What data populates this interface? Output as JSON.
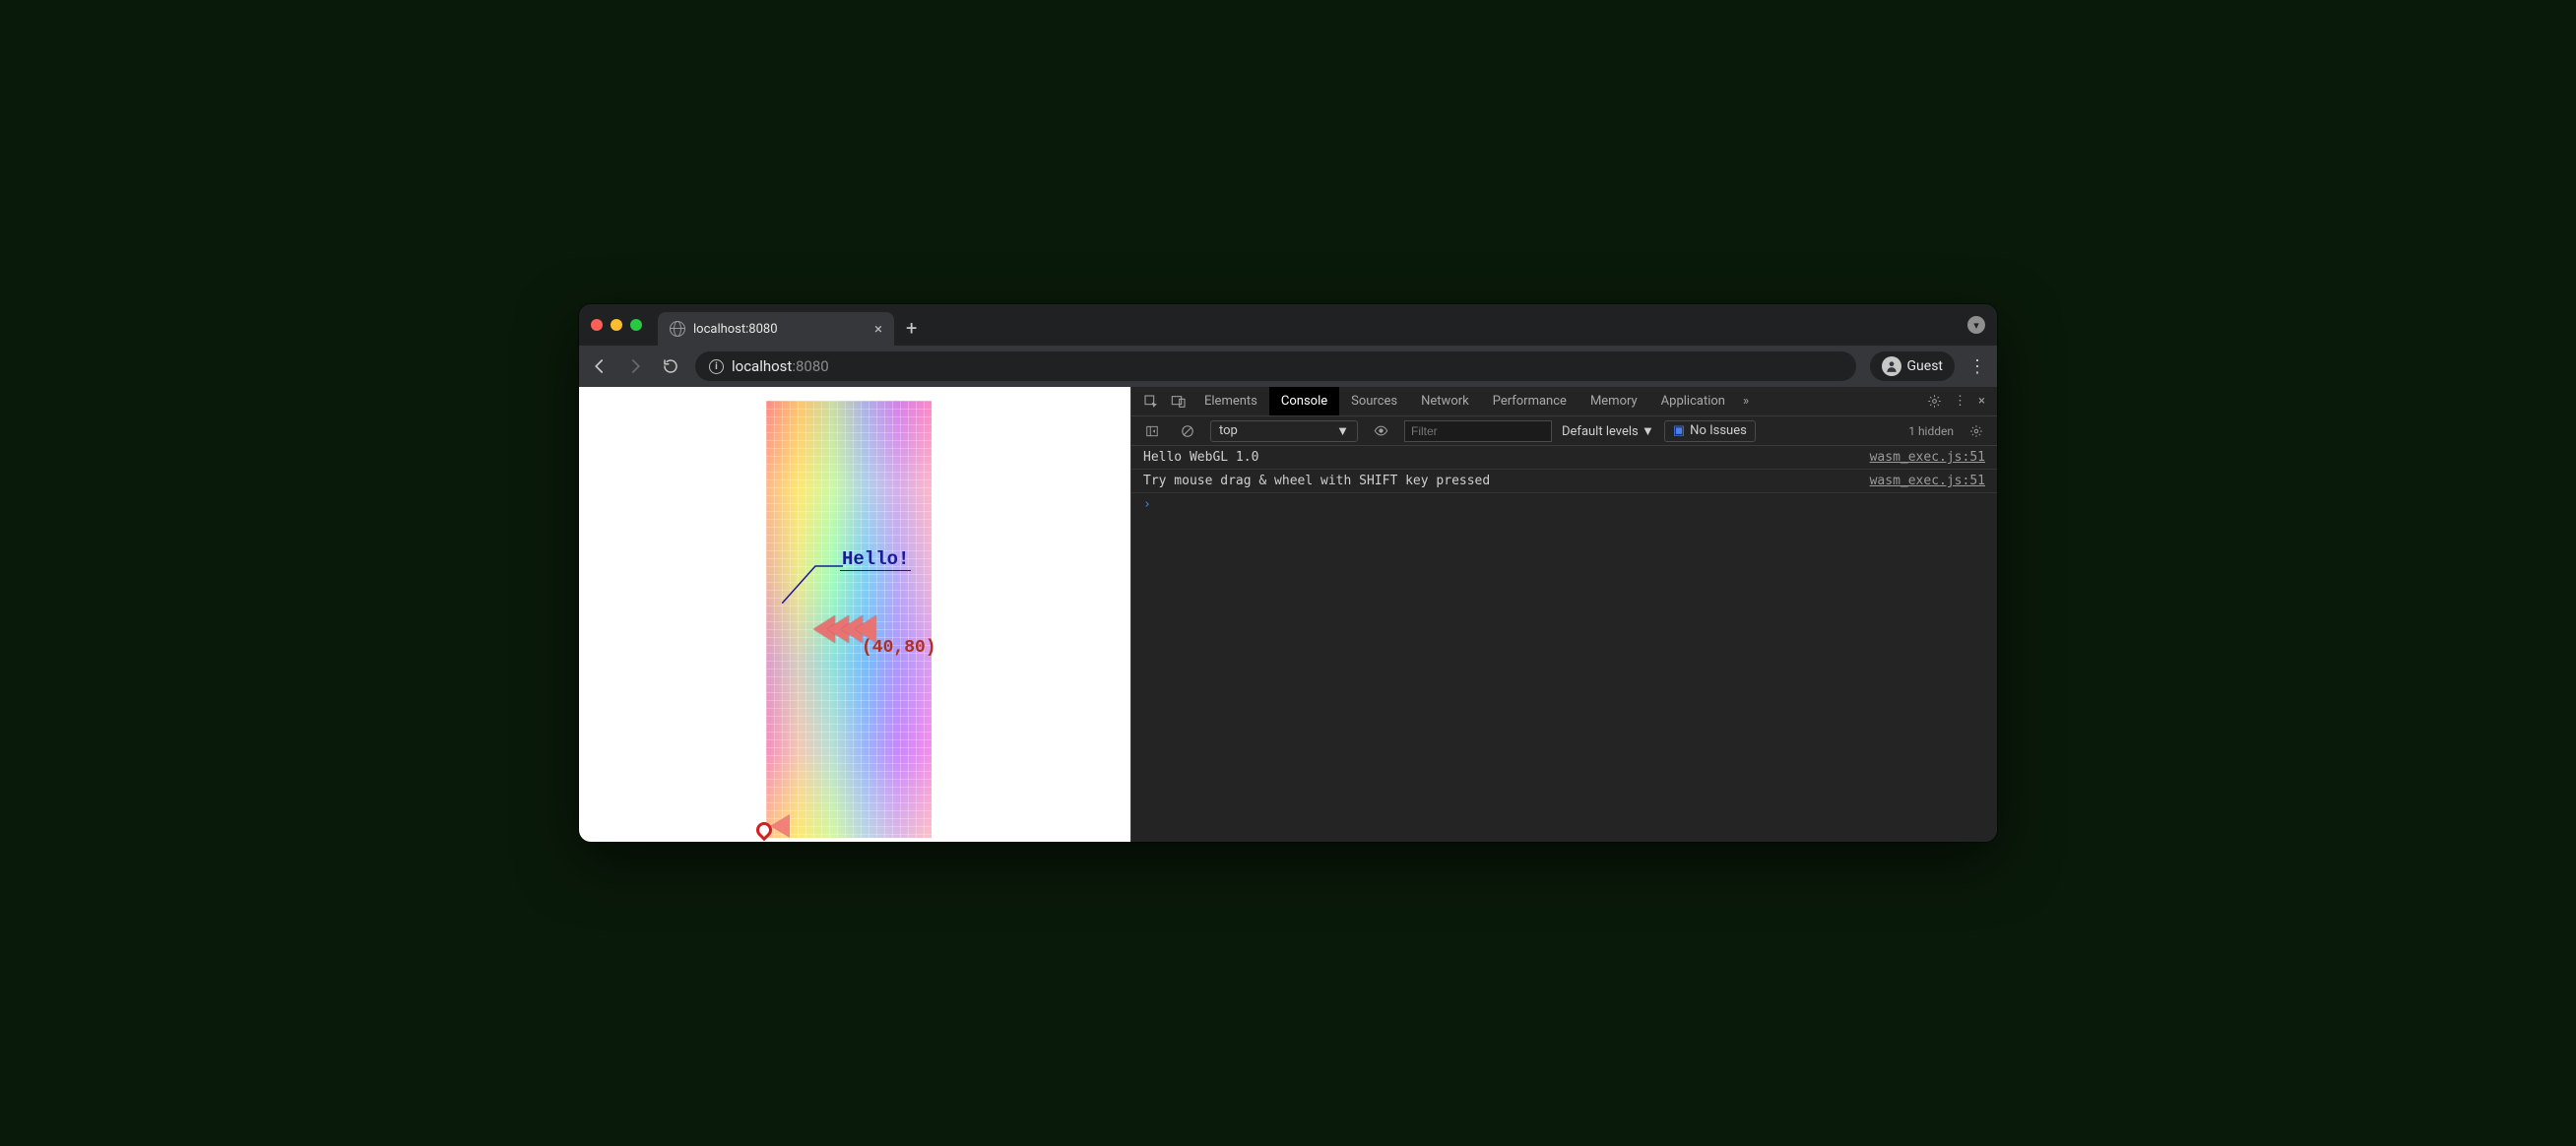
{
  "tab": {
    "title": "localhost:8080"
  },
  "omnibox": {
    "host": "localhost",
    "port": ":8080"
  },
  "guest_label": "Guest",
  "page": {
    "hello_text": "Hello!",
    "coord_text": "(40,80)"
  },
  "devtools": {
    "tabs": {
      "elements": "Elements",
      "console": "Console",
      "sources": "Sources",
      "network": "Network",
      "performance": "Performance",
      "memory": "Memory",
      "application": "Application"
    },
    "scope": "top",
    "filter_placeholder": "Filter",
    "levels": "Default levels",
    "no_issues": "No Issues",
    "hidden": "1 hidden",
    "log": [
      {
        "msg": "Hello WebGL 1.0",
        "src": "wasm_exec.js:51"
      },
      {
        "msg": "Try mouse drag & wheel with SHIFT key pressed",
        "src": "wasm_exec.js:51"
      }
    ]
  }
}
